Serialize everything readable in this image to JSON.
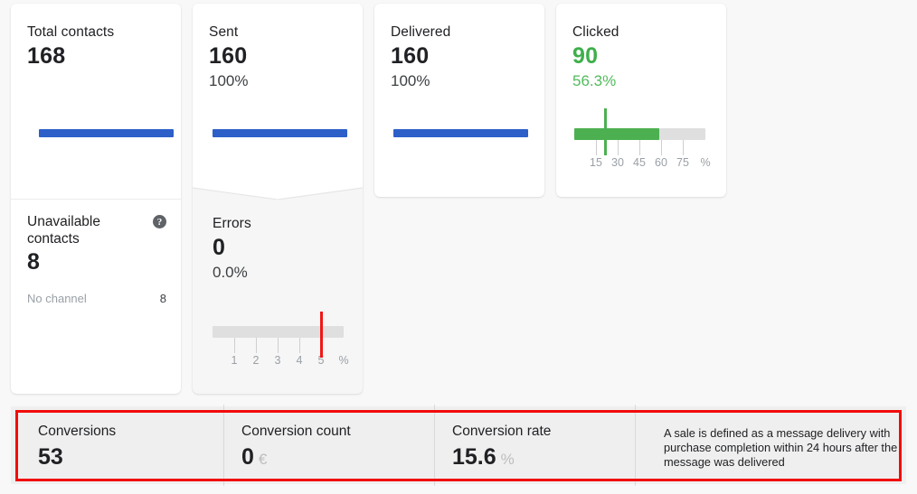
{
  "cards": [
    {
      "id": "total-contacts",
      "label": "Total contacts",
      "value": "168",
      "bar_pct": 100,
      "sub": {
        "label": "Unavailable contacts",
        "label_line1": "Unavailable",
        "label_line2": "contacts",
        "help_icon": "help-circle-icon",
        "help_glyph": "?",
        "value": "8",
        "breakdown": [
          {
            "name": "No channel",
            "count": "8"
          }
        ]
      }
    },
    {
      "id": "sent",
      "label": "Sent",
      "value": "160",
      "pct": "100%",
      "bar_pct": 100,
      "sub": {
        "label": "Errors",
        "value": "0",
        "pct": "0.0%",
        "gauge": {
          "type": "threshold",
          "fill_pct": 0,
          "threshold_value": 5,
          "threshold_color": "#f01717",
          "track_color": "#dfdfdf",
          "ticks": [
            "1",
            "2",
            "3",
            "4",
            "5"
          ],
          "unit": "%"
        }
      }
    },
    {
      "id": "delivered",
      "label": "Delivered",
      "value": "160",
      "pct": "100%",
      "bar_pct": 100
    },
    {
      "id": "clicked",
      "label": "Clicked",
      "value": "90",
      "pct": "56.3%",
      "accent": "#3eaf4b",
      "gauge": {
        "type": "progress",
        "fill_pct": 56.3,
        "fill_color": "#4cb050",
        "track_color": "#dfdfdf",
        "threshold_value": 18,
        "threshold_color": "#4cb050",
        "ticks": [
          "15",
          "30",
          "45",
          "60",
          "75"
        ],
        "unit": "%"
      }
    }
  ],
  "bottom_panel": {
    "highlight_color": "#f20c0c",
    "cells": [
      {
        "label": "Conversions",
        "value": "53",
        "unit": ""
      },
      {
        "label": "Conversion count",
        "value": "0",
        "unit": "€"
      },
      {
        "label": "Conversion rate",
        "value": "15.6",
        "unit": "%"
      }
    ],
    "note": "A sale is defined as a message delivery with purchase completion within 24 hours after the message was delivered"
  }
}
